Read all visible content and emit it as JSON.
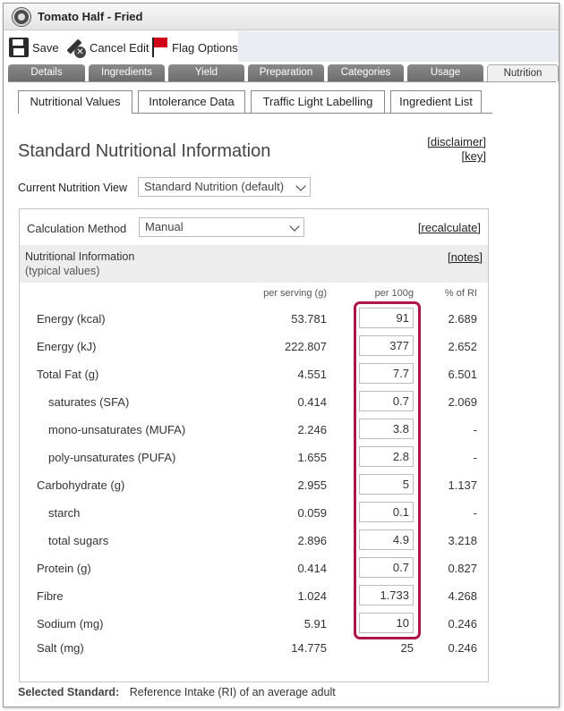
{
  "window": {
    "title": "Tomato Half - Fried"
  },
  "toolbar": {
    "save_label": "Save",
    "cancel_label": "Cancel Edit",
    "flag_label": "Flag Options"
  },
  "main_tabs": [
    {
      "label": "Details"
    },
    {
      "label": "Ingredients"
    },
    {
      "label": "Yield"
    },
    {
      "label": "Preparation"
    },
    {
      "label": "Categories"
    },
    {
      "label": "Usage"
    },
    {
      "label": "Nutrition",
      "active": true
    }
  ],
  "sub_tabs": [
    {
      "label": "Nutritional Values",
      "active": true
    },
    {
      "label": "Intolerance Data"
    },
    {
      "label": "Traffic Light Labelling"
    },
    {
      "label": "Ingredient List"
    }
  ],
  "page": {
    "heading": "Standard Nutritional Information",
    "disclaimer_link": "[disclaimer]",
    "key_link": "[key]",
    "view_label": "Current Nutrition View",
    "view_value": "Standard Nutrition (default)"
  },
  "panel": {
    "calc_label": "Calculation Method",
    "calc_value": "Manual",
    "recalc_link": "[recalculate]",
    "info_title": "Nutritional Information",
    "info_subtitle": "(typical values)",
    "notes_link": "[notes]",
    "col_serving": "per serving (g)",
    "col_100g": "per 100g",
    "col_ri": "% of RI"
  },
  "rows": [
    {
      "name": "Energy (kcal)",
      "serving": "53.781",
      "per100": "91",
      "ri": "2.689",
      "indent": false
    },
    {
      "name": "Energy (kJ)",
      "serving": "222.807",
      "per100": "377",
      "ri": "2.652",
      "indent": false
    },
    {
      "name": "Total Fat (g)",
      "serving": "4.551",
      "per100": "7.7",
      "ri": "6.501",
      "indent": false
    },
    {
      "name": "saturates (SFA)",
      "serving": "0.414",
      "per100": "0.7",
      "ri": "2.069",
      "indent": true
    },
    {
      "name": "mono-unsaturates (MUFA)",
      "serving": "2.246",
      "per100": "3.8",
      "ri": "-",
      "indent": true
    },
    {
      "name": "poly-unsaturates (PUFA)",
      "serving": "1.655",
      "per100": "2.8",
      "ri": "-",
      "indent": true
    },
    {
      "name": "Carbohydrate (g)",
      "serving": "2.955",
      "per100": "5",
      "ri": "1.137",
      "indent": false
    },
    {
      "name": "starch",
      "serving": "0.059",
      "per100": "0.1",
      "ri": "-",
      "indent": true
    },
    {
      "name": "total sugars",
      "serving": "2.896",
      "per100": "4.9",
      "ri": "3.218",
      "indent": true
    },
    {
      "name": "Protein (g)",
      "serving": "0.414",
      "per100": "0.7",
      "ri": "0.827",
      "indent": false
    },
    {
      "name": "Fibre",
      "serving": "1.024",
      "per100": "1.733",
      "ri": "4.268",
      "indent": false
    },
    {
      "name": "Sodium (mg)",
      "serving": "5.91",
      "per100": "10",
      "ri": "0.246",
      "indent": false
    }
  ],
  "salt_row": {
    "name": "Salt (mg)",
    "serving": "14.775",
    "per100": "25",
    "ri": "0.246"
  },
  "footer": {
    "label": "Selected Standard:",
    "value": "Reference Intake (RI) of an average adult"
  },
  "colors": {
    "highlight": "#b0154a",
    "tab_bg": "#7a7a7a",
    "flag": "#d0021b"
  }
}
